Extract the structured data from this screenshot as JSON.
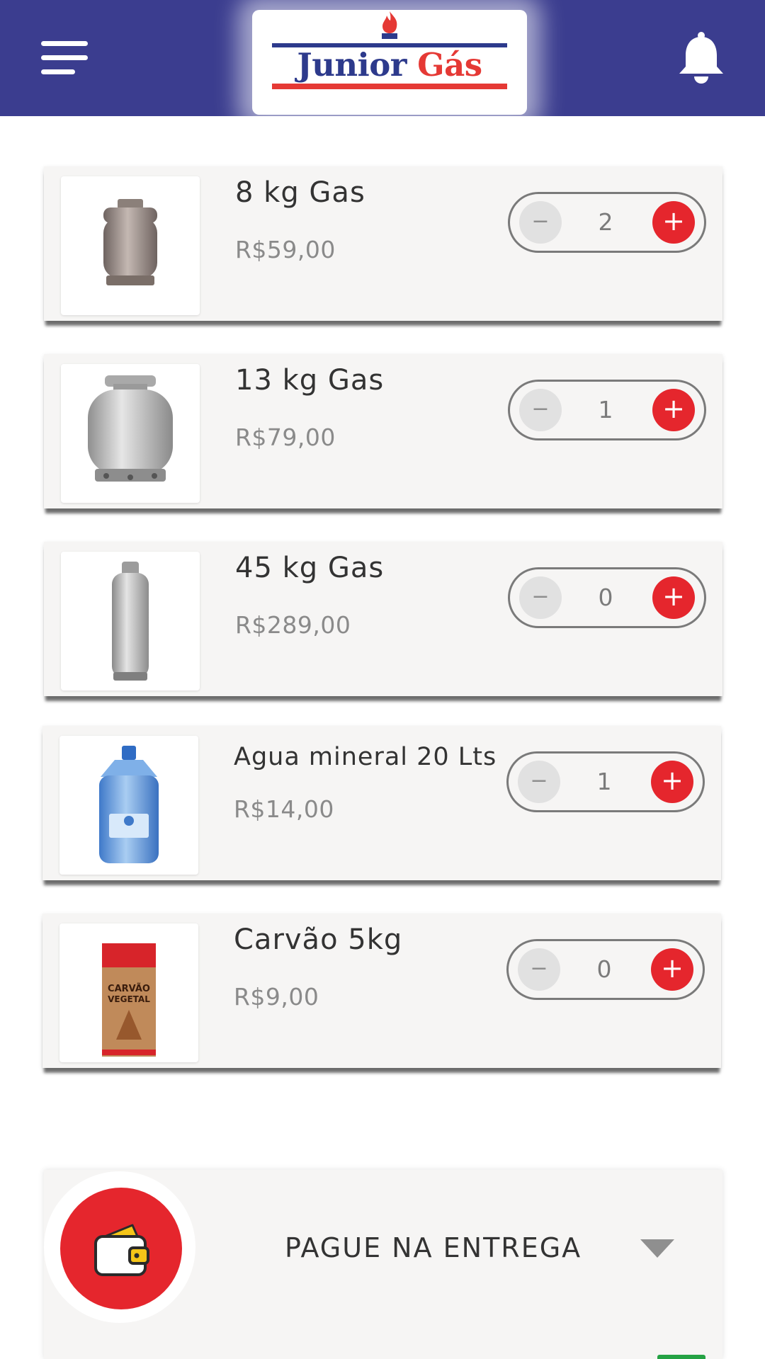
{
  "header": {
    "logo_word1": "Junior",
    "logo_word2": "Gás",
    "bg_color": "#3b3d8f",
    "menu_icon": "hamburger-menu-icon",
    "notification_icon": "bell-icon"
  },
  "products": [
    {
      "name": "8 kg Gas",
      "price": "R$59,00",
      "quantity": "2",
      "image": "8kg-gas-cylinder"
    },
    {
      "name": "13 kg Gas",
      "price": "R$79,00",
      "quantity": "1",
      "image": "13kg-gas-cylinder"
    },
    {
      "name": "45 kg Gas",
      "price": "R$289,00",
      "quantity": "0",
      "image": "45kg-gas-cylinder"
    },
    {
      "name": "Agua mineral 20 Lts",
      "price": "R$14,00",
      "quantity": "1",
      "image": "water-jug"
    },
    {
      "name": "Carvão 5kg",
      "price": "R$9,00",
      "quantity": "0",
      "image": "charcoal-bag"
    }
  ],
  "stepper": {
    "decrement": "−",
    "increment": "+"
  },
  "charcoal_bag_text": [
    "CARVÃO",
    "VEGETAL"
  ],
  "payment": {
    "label": "PAGUE NA ENTREGA",
    "icon": "wallet-icon"
  },
  "colors": {
    "accent_red": "#e5262d",
    "card_bg": "#f6f5f4",
    "brand_blue": "#3b3d8f"
  }
}
